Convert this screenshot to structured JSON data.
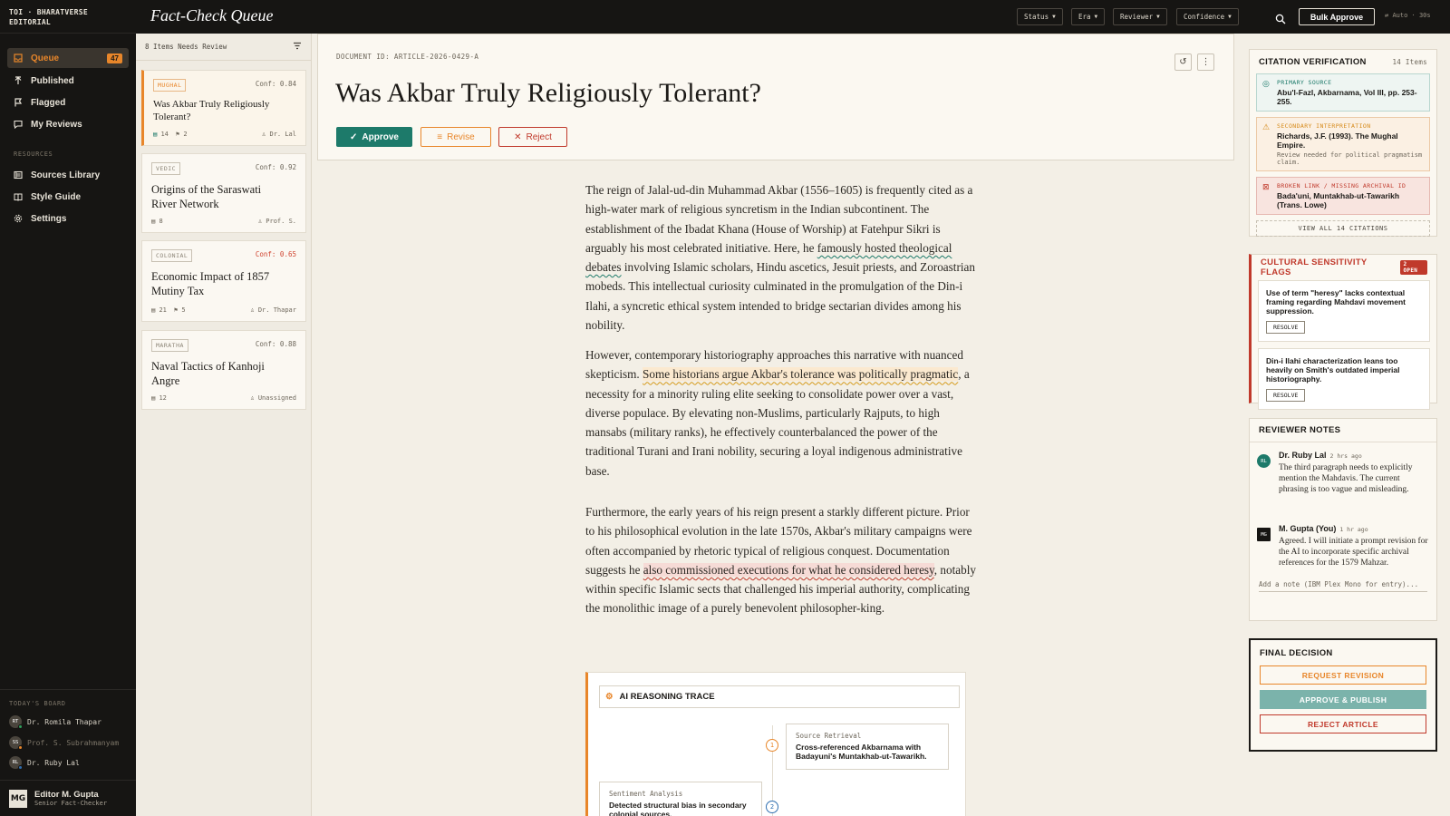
{
  "app": {
    "brand": "TOI · BHARATVERSE EDITORIAL",
    "title": "Fact-Check Queue"
  },
  "sidebar": {
    "items": [
      {
        "label": "Queue",
        "count": "47",
        "icon": "inbox-icon"
      },
      {
        "label": "Published",
        "icon": "upload-icon"
      },
      {
        "label": "Flagged",
        "icon": "flag-icon"
      },
      {
        "label": "My Reviews",
        "icon": "chat-icon"
      }
    ],
    "resources_label": "RESOURCES",
    "resources": [
      {
        "label": "Sources Library",
        "icon": "library-icon"
      },
      {
        "label": "Style Guide",
        "icon": "book-icon"
      },
      {
        "label": "Settings",
        "icon": "gear-icon"
      }
    ],
    "board_label": "TODAY'S BOARD",
    "board": [
      {
        "initials": "RT",
        "name": "Dr. Romila Thapar",
        "status_color": "#2e9e5b"
      },
      {
        "initials": "SS",
        "name": "Prof. S. Subrahmanyam",
        "status_color": "#e8862a"
      },
      {
        "initials": "RL",
        "name": "Dr. Ruby Lal",
        "status_color": "#2f6fb0"
      }
    ],
    "editor": {
      "initials": "MG",
      "name": "Editor M. Gupta",
      "role": "Senior Fact-Checker"
    }
  },
  "topbar": {
    "filters": [
      "Status",
      "Era",
      "Reviewer",
      "Confidence"
    ],
    "bulk_label": "Bulk Approve",
    "auto_label": "Auto · 30s"
  },
  "queue": {
    "header": "8 Items Needs Review",
    "cards": [
      {
        "tag": "MUGHAL",
        "conf": "Conf: 0.84",
        "title": "Was Akbar Truly Religiously Tolerant?",
        "cites": "14",
        "flags": "2",
        "reviewer": "Dr. Lal"
      },
      {
        "tag": "VEDIC",
        "conf": "Conf: 0.92",
        "title": "Origins of the Saraswati River Network",
        "cites": "8",
        "flags": "",
        "reviewer": "Prof. S."
      },
      {
        "tag": "COLONIAL",
        "conf": "Conf: 0.65",
        "title": "Economic Impact of 1857 Mutiny Tax",
        "cites": "21",
        "flags": "5",
        "reviewer": "Dr. Thapar"
      },
      {
        "tag": "MARATHA",
        "conf": "Conf: 0.88",
        "title": "Naval Tactics of Kanhoji Angre",
        "cites": "12",
        "flags": "",
        "reviewer": "Unassigned"
      }
    ]
  },
  "document": {
    "doc_id": "DOCUMENT ID: ARTICLE-2026-0429-A",
    "title": "Was Akbar Truly Religiously Tolerant?",
    "approve": "Approve",
    "revise": "Revise",
    "reject": "Reject",
    "p1": {
      "a": "The reign of Jalal-ud-din Muhammad Akbar (1556–1605) is frequently cited as a high-water mark of religious syncretism in the Indian subcontinent. The establishment of the Ibadat Khana (House of Worship) at Fatehpur Sikri is arguably his most celebrated initiative. Here, he ",
      "hl": "famously hosted theological debates",
      "b": " involving Islamic scholars, Hindu ascetics, Jesuit priests, and Zoroastrian mobeds. This intellectual curiosity culminated in the promulgation of the Din-i Ilahi, a syncretic ethical system intended to bridge sectarian divides among his nobility."
    },
    "p2": {
      "a": "However, contemporary historiography approaches this narrative with nuanced skepticism. ",
      "hl": "Some historians argue Akbar's tolerance was politically pragmatic",
      "b": ", a necessity for a minority ruling elite seeking to consolidate power over a vast, diverse populace. By elevating non-Muslims, particularly Rajputs, to high mansabs (military ranks), he effectively counterbalanced the power of the traditional Turani and Irani nobility, securing a loyal indigenous administrative base."
    },
    "p3": {
      "a": "Furthermore, the early years of his reign present a starkly different picture. Prior to his philosophical evolution in the late 1570s, Akbar's military campaigns were often accompanied by rhetoric typical of religious conquest. Documentation suggests he ",
      "hl": "also commissioned executions for what he considered heresy",
      "b": ", notably within specific Islamic sects that challenged his imperial authority, complicating the monolithic image of a purely benevolent philosopher-king."
    },
    "trace": {
      "title": "AI REASONING TRACE",
      "steps": [
        {
          "num": "1",
          "kind": "Source Retrieval",
          "text": "Cross-referenced Akbarnama with Badayuni's Muntakhab-ut-Tawarikh."
        },
        {
          "num": "2",
          "kind": "Sentiment Analysis",
          "text": "Detected structural bias in secondary colonial sources."
        }
      ]
    }
  },
  "citations": {
    "title": "CITATION VERIFICATION",
    "count": "14 Items",
    "items": [
      {
        "label": "PRIMARY SOURCE",
        "text": "Abu'l-Fazl, Akbarnama, Vol III, pp. 253-255.",
        "note": "",
        "status": "verified",
        "color": "#1d7a6a"
      },
      {
        "label": "SECONDARY INTERPRETATION",
        "text": "Richards, J.F. (1993). The Mughal Empire.",
        "note": "Review needed for political pragmatism claim.",
        "status": "warning",
        "color": "#d68a1a"
      },
      {
        "label": "BROKEN LINK / MISSING ARCHIVAL ID",
        "text": "Bada'uni, Muntakhab-ut-Tawarikh (Trans. Lowe)",
        "note": "",
        "status": "error",
        "color": "#c0392b"
      }
    ],
    "view_all": "VIEW ALL 14 CITATIONS"
  },
  "flags": {
    "title": "CULTURAL SENSITIVITY FLAGS",
    "badge": "2 OPEN",
    "items": [
      {
        "text": "Use of term \"heresy\" lacks contextual framing regarding Mahdavi movement suppression.",
        "action": "RESOLVE"
      },
      {
        "text": "Din-i Ilahi characterization leans too heavily on Smith's outdated imperial historiography.",
        "action": "RESOLVE"
      }
    ]
  },
  "notes": {
    "title": "REVIEWER NOTES",
    "items": [
      {
        "initials": "RL",
        "name": "Dr. Ruby Lal",
        "time": "2 hrs ago",
        "text": "The third paragraph needs to explicitly mention the Mahdavis. The current phrasing is too vague and misleading."
      },
      {
        "initials": "MG",
        "name": "M. Gupta (You)",
        "time": "1 hr ago",
        "text": "Agreed. I will initiate a prompt revision for the AI to incorporate specific archival references for the 1579 Mahzar."
      }
    ],
    "placeholder": "Add a note (IBM Plex Mono for entry)..."
  },
  "decision": {
    "title": "FINAL DECISION",
    "request": "REQUEST REVISION",
    "publish": "APPROVE & PUBLISH",
    "reject": "REJECT ARTICLE"
  },
  "colors": {
    "accent": "#e8862a",
    "approve": "#1d7a6a",
    "reject": "#c0392b",
    "dark": "#161513"
  }
}
